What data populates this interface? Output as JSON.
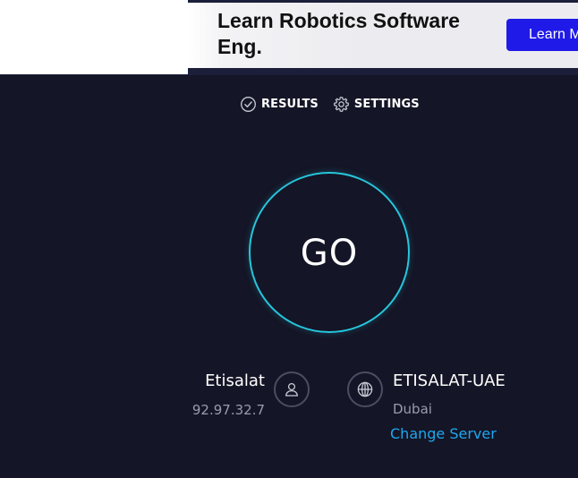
{
  "ad": {
    "headline": "Learn Robotics Software Eng.",
    "cta_label": "Learn M"
  },
  "nav": {
    "results_label": "RESULTS",
    "results_icon": "check-circle-icon",
    "settings_label": "SETTINGS",
    "settings_icon": "gear-icon"
  },
  "go_button": {
    "label": "GO",
    "ring_color": "#26c6dc"
  },
  "provider": {
    "name": "Etisalat",
    "ip": "92.97.32.7",
    "icon": "user-icon"
  },
  "server": {
    "name": "ETISALAT-UAE",
    "location": "Dubai",
    "change_label": "Change Server",
    "icon": "globe-icon"
  },
  "colors": {
    "background": "#141526",
    "accent": "#26c6dc",
    "link": "#1ea7f0",
    "ad_button": "#1f1ae8"
  }
}
